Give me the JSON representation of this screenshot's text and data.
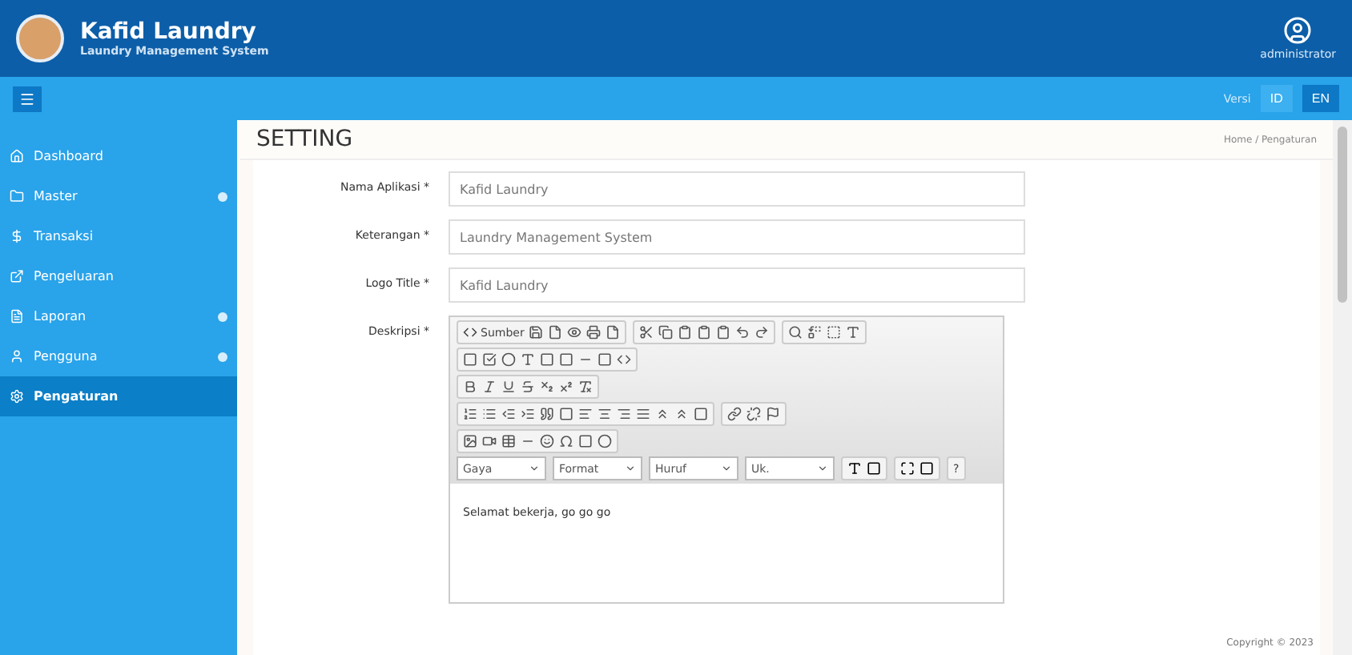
{
  "header": {
    "app_name": "Kafid Laundry",
    "tagline": "Laundry Management System",
    "user": "administrator"
  },
  "topbar": {
    "version_label": "Versi",
    "languages": [
      {
        "label": "ID",
        "selected": false
      },
      {
        "label": "EN",
        "selected": true
      }
    ]
  },
  "sidebar": {
    "items": [
      {
        "label": "Dashboard",
        "kind": "home",
        "has_submenu": false,
        "selected": false
      },
      {
        "label": "Master",
        "kind": "folder",
        "has_submenu": true,
        "selected": false
      },
      {
        "label": "Transaksi",
        "kind": "money",
        "has_submenu": false,
        "selected": false
      },
      {
        "label": "Pengeluaran",
        "kind": "out",
        "has_submenu": false,
        "selected": false
      },
      {
        "label": "Laporan",
        "kind": "report",
        "has_submenu": true,
        "selected": false
      },
      {
        "label": "Pengguna",
        "kind": "user",
        "has_submenu": true,
        "selected": false
      },
      {
        "label": "Pengaturan",
        "kind": "settings",
        "has_submenu": false,
        "selected": true
      }
    ]
  },
  "page": {
    "title": "SETTING",
    "breadcrumb": "Home / Pengaturan"
  },
  "form": {
    "fields": [
      {
        "label": "Nama Aplikasi *",
        "value": "Kafid Laundry"
      },
      {
        "label": "Keterangan *",
        "value": "Laundry Management System"
      },
      {
        "label": "Logo Title *",
        "value": "Kafid Laundry"
      }
    ],
    "editor": {
      "label": "Deskripsi *",
      "source_button": "Sumber",
      "combos": [
        "Gaya",
        "Format",
        "Huruf",
        "Uk."
      ],
      "help": "?",
      "content": "Selamat bekerja, go go go"
    }
  },
  "footer": {
    "copyright": "Copyright © 2023"
  }
}
